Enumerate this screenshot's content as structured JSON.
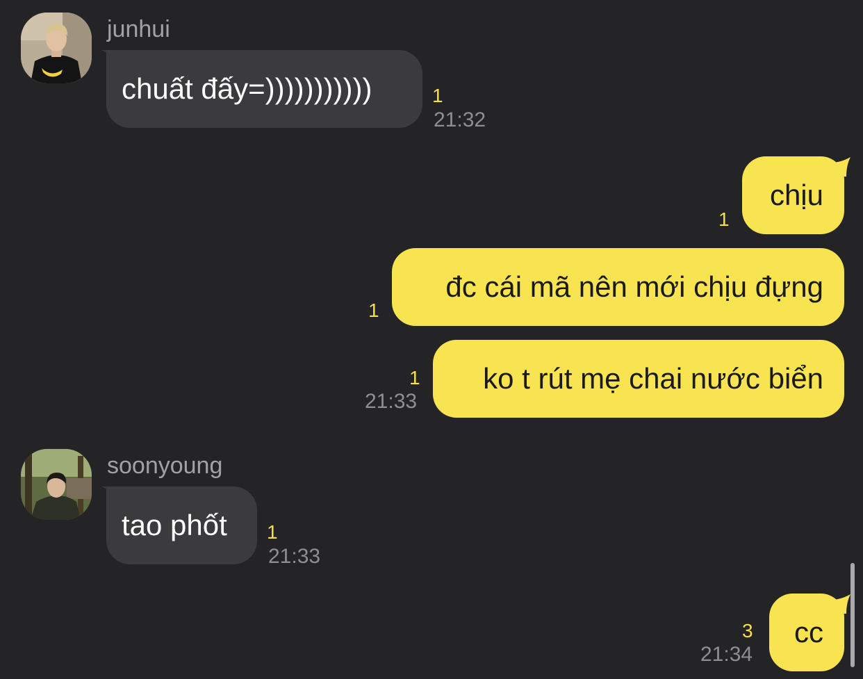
{
  "messages": [
    {
      "sender": "junhui",
      "direction": "in",
      "text": "chuất đấy=)))))))))))",
      "unread": "1",
      "time": "21:32"
    },
    {
      "direction": "out",
      "text": "chịu",
      "unread": "1"
    },
    {
      "direction": "out",
      "text": "đc cái mã nên mới chịu đựng",
      "unread": "1"
    },
    {
      "direction": "out",
      "text": "ko t rút mẹ chai nước biển",
      "unread": "1",
      "time": "21:33"
    },
    {
      "sender": "soonyoung",
      "direction": "in",
      "text": "tao phốt",
      "unread": "1",
      "time": "21:33"
    },
    {
      "direction": "out",
      "text": "cc",
      "unread": "3",
      "time": "21:34"
    }
  ],
  "colors": {
    "background": "#242426",
    "incoming_bubble": "#3b3b3e",
    "outgoing_bubble": "#f8e451",
    "unread_count": "#f6df47",
    "timestamp": "#8e8e93",
    "sender_name": "#a2a2a6"
  }
}
